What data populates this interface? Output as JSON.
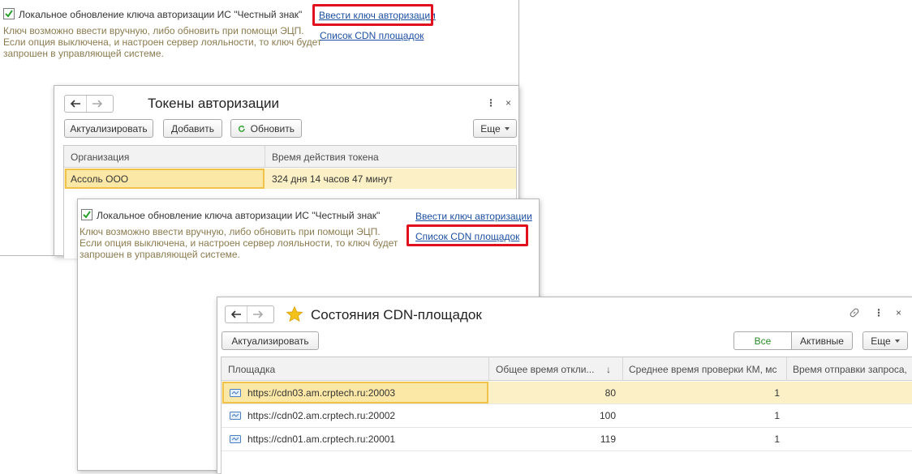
{
  "top_option": {
    "checkbox_label": "Локальное обновление ключа авторизации ИС \"Честный знак\"",
    "hint_lines": [
      "Ключ возможно ввести вручную, либо обновить при помощи ЭЦП.",
      "Если опция выключена, и настроен сервер лояльности, то ключ будет",
      "запрошен в управляющей системе."
    ],
    "link_enter_key": "Ввести ключ авторизации",
    "link_cdn_list": "Список CDN площадок"
  },
  "tokens_window": {
    "title": "Токены авторизации",
    "buttons": {
      "refresh_actual": "Актуализировать",
      "add": "Добавить",
      "update": "Обновить",
      "more": "Еще"
    },
    "columns": [
      "Организация",
      "Время действия токена"
    ],
    "rows": [
      {
        "organization": "Ассоль ООО",
        "token_time": "324 дня 14 часов 47 минут"
      }
    ]
  },
  "mid_option": {
    "checkbox_label": "Локальное обновление ключа авторизации ИС \"Честный знак\"",
    "hint_lines": [
      "Ключ возможно ввести вручную, либо обновить при помощи ЭЦП.",
      "Если опция выключена, и настроен сервер лояльности, то ключ будет",
      "запрошен в управляющей системе."
    ],
    "link_enter_key": "Ввести ключ авторизации",
    "link_cdn_list": "Список CDN площадок"
  },
  "cdn_window": {
    "title": "Состояния CDN-площадок",
    "buttons": {
      "refresh_actual": "Актуализировать",
      "all": "Все",
      "active": "Активные",
      "more": "Еще"
    },
    "columns": [
      "Площадка",
      "Общее время откли...",
      "Среднее время проверки КМ, мс",
      "Время отправки запроса,"
    ],
    "sort_indicator": "↓",
    "rows": [
      {
        "site": "https://cdn03.am.crptech.ru:20003",
        "total": "80",
        "avg": "1",
        "sent": ""
      },
      {
        "site": "https://cdn02.am.crptech.ru:20002",
        "total": "100",
        "avg": "1",
        "sent": ""
      },
      {
        "site": "https://cdn01.am.crptech.ru:20001",
        "total": "119",
        "avg": "1",
        "sent": ""
      }
    ]
  },
  "colors": {
    "check_green": "#2aa02a",
    "link_blue": "#1d4fa0",
    "highlight_red": "#e0101e",
    "hint_olive": "#8b7b4f",
    "selected_row": "#fbf0c6",
    "favorite_star": "#f2c21b"
  }
}
